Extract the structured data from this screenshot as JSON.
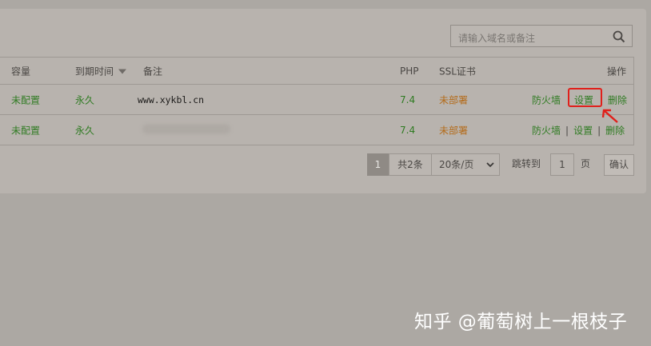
{
  "search": {
    "placeholder": "请输入域名或备注"
  },
  "columns": {
    "capacity": "容量",
    "expire": "到期时间",
    "note": "备注",
    "php": "PHP",
    "ssl": "SSL证书",
    "actions": "操作"
  },
  "rows": [
    {
      "capacity": "未配置",
      "expire": "永久",
      "note": "www.xykbl.cn",
      "php": "7.4",
      "ssl": "未部署",
      "firewall": "防火墙",
      "settings": "设置",
      "delete": "删除"
    },
    {
      "capacity": "未配置",
      "expire": "永久",
      "note": "",
      "php": "7.4",
      "ssl": "未部署",
      "firewall": "防火墙",
      "settings": "设置",
      "delete": "删除"
    }
  ],
  "separator": "|",
  "pager": {
    "current": "1",
    "total": "共2条",
    "page_size": "20条/页",
    "jump_label": "跳转到",
    "jump_value": "1",
    "page_label": "页",
    "confirm": "确认"
  },
  "watermark": "知乎 @葡萄树上一根枝子",
  "colors": {
    "green": "#2f7b22",
    "orange": "#b46b19",
    "highlight": "#e0201b"
  }
}
